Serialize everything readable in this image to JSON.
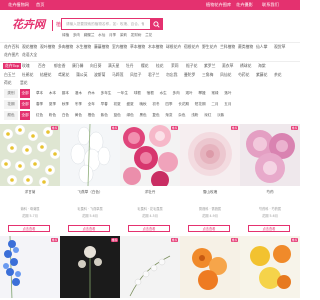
{
  "topbar": {
    "left_links": [
      "花卉植物网",
      "首页"
    ],
    "right_links": [
      "植物花卉图库",
      "花卉摄影",
      "联系我们"
    ]
  },
  "logo": {
    "text": "花卉网",
    "subtitle": "植物花卉"
  },
  "search": {
    "placeholder": "请输入您要搜索的植物名称，如：玫瑰、百合、郁金香等花卉",
    "button_icon": "search-icon"
  },
  "hot_searches": [
    "绿植",
    "多肉",
    "蝴蝶兰",
    "水仙",
    "月季",
    "茉莉",
    "发财树",
    "兰花"
  ],
  "categories_row1": [
    "花卉百科",
    "观花植物",
    "观叶植物",
    "多肉植物",
    "水生植物",
    "藤蔓植物",
    "室内植物",
    "草本植物",
    "木本植物",
    "球根花卉",
    "宿根花卉",
    "野生花卉",
    "兰科植物",
    "蕨类植物",
    "仙人掌",
    "观赏草"
  ],
  "categories_row2": [
    "花卉图片",
    "花语大全"
  ],
  "categories_row3": [
    "花卉Top",
    "玫瑰",
    "百合",
    "郁金香",
    "康乃馨",
    "向日葵",
    "满天星",
    "牡丹",
    "樱花",
    "桂花",
    "茉莉",
    "栀子花",
    "紫罗兰",
    "薰衣草",
    "绣球花",
    "海棠"
  ],
  "categories_row4": [
    "白玉兰",
    "杜鹃花",
    "桔梗花",
    "鸢尾花",
    "蒲公英",
    "波斯菊",
    "马蹄莲",
    "风信子",
    "君子兰",
    "勿忘我",
    "曼陀罗",
    "三角梅",
    "凤仙花",
    "芍药花",
    "紫藤花",
    "茶花"
  ],
  "categories_row5": [
    "荷花",
    "昙花"
  ],
  "filters": [
    {
      "label": "类别",
      "options": [
        "全部",
        "草本",
        "木本",
        "藤本",
        "灌木",
        "乔木",
        "多年生",
        "一年生",
        "球根",
        "宿根",
        "水生",
        "多肉",
        "观叶",
        "攀援",
        "常绿",
        "落叶"
      ]
    },
    {
      "label": "花期",
      "options": [
        "全部",
        "春季",
        "夏季",
        "秋季",
        "冬季",
        "全年",
        "早春",
        "初夏",
        "盛夏",
        "晚秋",
        "初冬",
        "四季",
        "长花期",
        "短花期",
        "二月",
        "五月"
      ]
    },
    {
      "label": "颜色",
      "options": [
        "全部",
        "红色",
        "粉色",
        "白色",
        "黄色",
        "橙色",
        "紫色",
        "蓝色",
        "绿色",
        "黑色",
        "复色",
        "渐变",
        "杂色",
        "浅粉",
        "深红",
        "淡紫",
        "橘红"
      ]
    }
  ],
  "products": [
    {
      "name": "洋甘菊",
      "line1": "菊科 · 母菊属",
      "line2": "花期 5-7月",
      "button": "点击查看",
      "badge": "推荐"
    },
    {
      "name": "飞燕草（白色）",
      "line1": "毛茛科 · 飞燕草属",
      "line2": "花期 5-6月",
      "button": "点击查看",
      "badge": "推荐"
    },
    {
      "name": "洋牡丹",
      "line1": "毛茛科 · 花毛茛属",
      "line2": "花期 4-5月",
      "button": "点击查看",
      "badge": "推荐"
    },
    {
      "name": "雪山玫瑰",
      "line1": "蔷薇科 · 蔷薇属",
      "line2": "花期 4-9月",
      "button": "点击查看",
      "badge": "推荐"
    },
    {
      "name": "芍药",
      "line1": "芍药科 · 芍药属",
      "line2": "花期 5-6月",
      "button": "点击查看",
      "badge": "推荐"
    }
  ],
  "photos_row2": [
    {
      "badge": "推荐"
    },
    {
      "badge": "推荐"
    },
    {
      "badge": "推荐"
    },
    {
      "badge": "推荐"
    },
    {
      "badge": "推荐"
    }
  ],
  "colors": {
    "accent": "#e4316f"
  }
}
